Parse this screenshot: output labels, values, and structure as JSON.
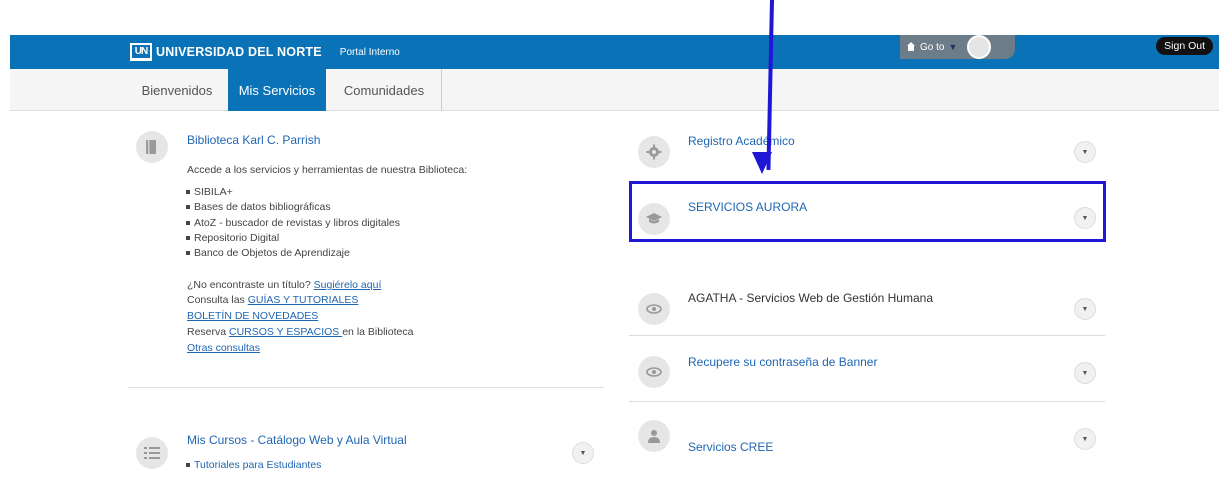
{
  "header": {
    "brand_logo": "UN",
    "brand_name": "UNIVERSIDAD DEL NORTE",
    "brand_subtitle": "Portal Interno",
    "goto_label": "Go to",
    "signout_label": "Sign Out"
  },
  "tabs": [
    {
      "label": "Bienvenidos",
      "active": false
    },
    {
      "label": "Mis Servicios",
      "active": true
    },
    {
      "label": "Comunidades",
      "active": false
    }
  ],
  "left": {
    "library": {
      "title": "Biblioteca Karl C. Parrish",
      "intro": "Accede a los servicios y herramientas de nuestra Biblioteca:",
      "items": [
        "SIBILA+",
        "Bases de datos bibliográficas",
        "AtoZ - buscador de revistas y libros digitales",
        "Repositorio Digital",
        "Banco de Objetos de Aprendizaje"
      ],
      "line1_text": "¿No encontraste un título? ",
      "line1_link": "Sugiérelo aquí",
      "line2_text": "Consulta las ",
      "line2_link": "GUÍAS Y TUTORIALES",
      "line3_link": "BOLETÍN DE NOVEDADES",
      "line4_text": "Reserva ",
      "line4_link": "CURSOS Y ESPACIOS ",
      "line4_suffix": "en la Biblioteca",
      "line5_link": "Otras consultas"
    },
    "courses": {
      "title": "Mis Cursos - Catálogo Web y Aula Virtual",
      "items": [
        "Tutoriales para Estudiantes"
      ]
    }
  },
  "right": {
    "items": [
      {
        "title": "Registro Académico",
        "icon": "gear-icon"
      },
      {
        "title": "SERVICIOS AURORA",
        "icon": "graduation-cap-icon"
      },
      {
        "title": "AGATHA - Servicios Web de Gestión Humana",
        "icon": "eye-icon"
      },
      {
        "title": "Recupere su contraseña de Banner",
        "icon": "eye-icon"
      },
      {
        "title": "Servicios CREE",
        "icon": "user-group-icon"
      }
    ]
  },
  "colors": {
    "brand_blue": "#0a72b6",
    "link_blue": "#1f66b3",
    "annotation_blue": "#1f16d6"
  }
}
